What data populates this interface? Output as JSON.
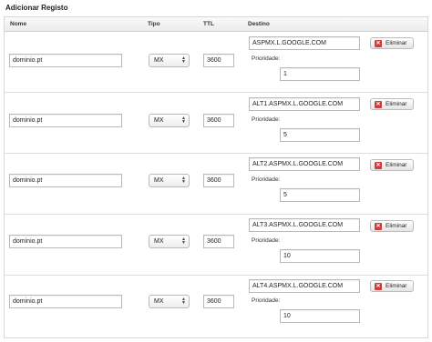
{
  "section": {
    "title": "Adicionar Registo"
  },
  "columns": {
    "nome": "Nome",
    "tipo": "Tipo",
    "ttl": "TTL",
    "destino": "Destino"
  },
  "rows": [
    {
      "nome": "dominio.pt",
      "tipo": "MX",
      "ttl": "3600",
      "destino": "ASPMX.L.GOOGLE.COM",
      "prioridade_label": "Prioridade:",
      "prioridade": "1",
      "delete_label": "Eliminar"
    },
    {
      "nome": "dominio.pt",
      "tipo": "MX",
      "ttl": "3600",
      "destino": "ALT1.ASPMX.L.GOOGLE.COM",
      "prioridade_label": "Prioridade:",
      "prioridade": "5",
      "delete_label": "Eliminar"
    },
    {
      "nome": "dominio.pt",
      "tipo": "MX",
      "ttl": "3600",
      "destino": "ALT2.ASPMX.L.GOOGLE.COM",
      "prioridade_label": "Prioridade:",
      "prioridade": "5",
      "delete_label": "Eliminar"
    },
    {
      "nome": "dominio.pt",
      "tipo": "MX",
      "ttl": "3600",
      "destino": "ALT3.ASPMX.L.GOOGLE.COM",
      "prioridade_label": "Prioridade:",
      "prioridade": "10",
      "delete_label": "Eliminar"
    },
    {
      "nome": "dominio.pt",
      "tipo": "MX",
      "ttl": "3600",
      "destino": "ALT4.ASPMX.L.GOOGLE.COM",
      "prioridade_label": "Prioridade:",
      "prioridade": "10",
      "delete_label": "Eliminar"
    }
  ],
  "icons": {
    "delete": "close-icon",
    "select": "updown-chevron-icon"
  },
  "colors": {
    "delete_icon": "#d23c3c",
    "header_bg": "#ececec",
    "border": "#d8d8d8"
  }
}
